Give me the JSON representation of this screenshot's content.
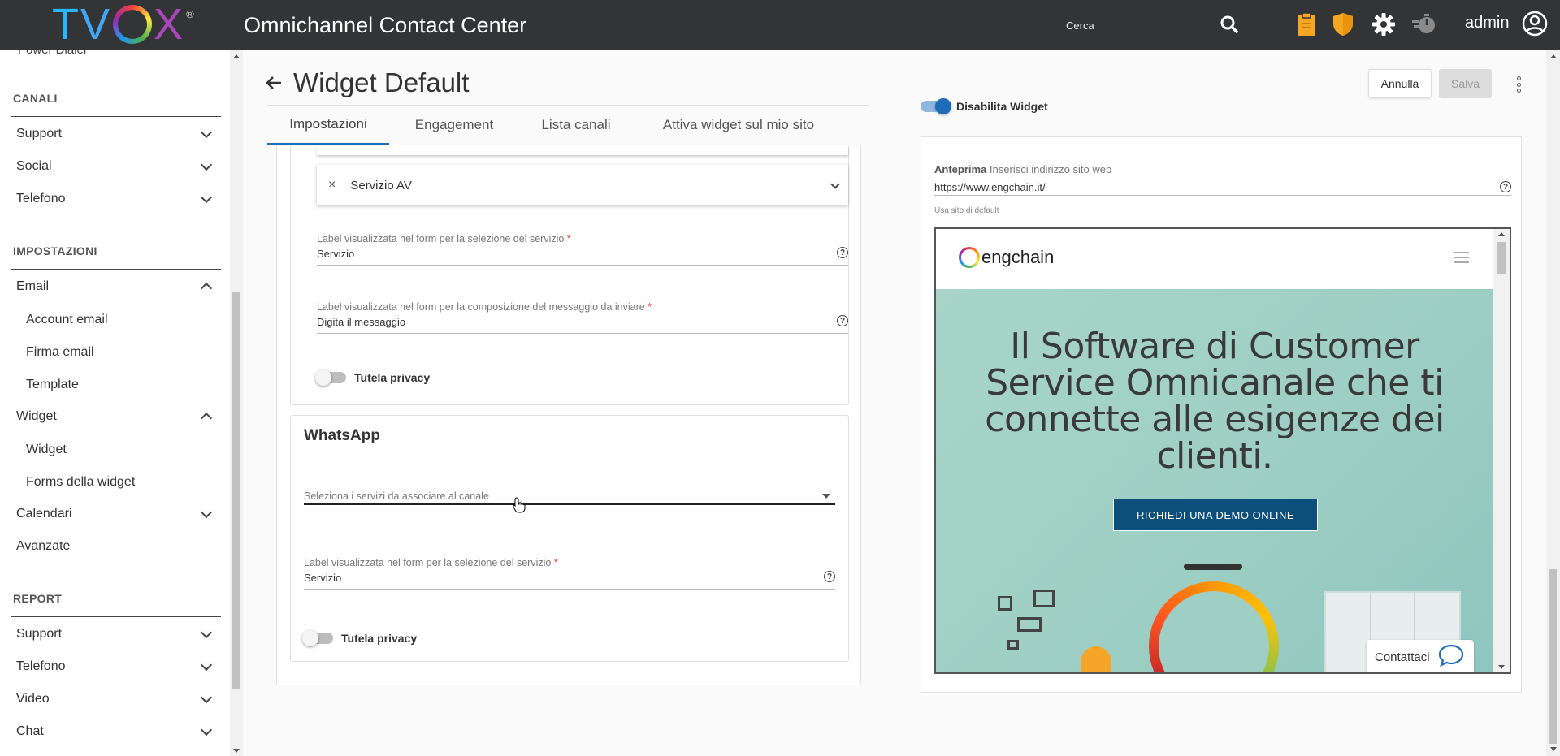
{
  "topbar": {
    "logo_letters": [
      "T",
      "V",
      "X"
    ],
    "logo_reg": "®",
    "app_title": "Omnichannel Contact Center",
    "search_placeholder": "Cerca",
    "user_label": "admin",
    "icons": [
      "search-icon",
      "clipboard-icon",
      "shield-icon",
      "gear-icon",
      "timer-icon",
      "user-circle-icon"
    ],
    "colors": {
      "bg": "#333436",
      "clipboard": "#f5a623",
      "shield": "#f5a623"
    }
  },
  "sidebar": {
    "cut_item": "Power Dialer",
    "sections": [
      {
        "title": "CANALI",
        "items": [
          {
            "label": "Support"
          },
          {
            "label": "Social"
          },
          {
            "label": "Telefono"
          }
        ]
      },
      {
        "title": "IMPOSTAZIONI",
        "items": [
          {
            "label": "Email",
            "expanded": true,
            "sub": [
              "Account email",
              "Firma email",
              "Template"
            ]
          },
          {
            "label": "Widget",
            "expanded": true,
            "sub": [
              "Widget",
              "Forms della widget"
            ]
          },
          {
            "label": "Calendari"
          },
          {
            "label": "Avanzate"
          }
        ]
      },
      {
        "title": "REPORT",
        "items": [
          {
            "label": "Support"
          },
          {
            "label": "Telefono"
          },
          {
            "label": "Video"
          },
          {
            "label": "Chat"
          }
        ]
      }
    ]
  },
  "page": {
    "title": "Widget Default",
    "cancel_label": "Annulla",
    "save_label": "Salva",
    "tabs": [
      "Impostazioni",
      "Engagement",
      "Lista canali",
      "Attiva widget sul mio sito"
    ],
    "active_tab": "Impostazioni",
    "accent": "#1e6bb8"
  },
  "form": {
    "selected_service": "Servizio AV",
    "remove_symbol": "×",
    "service_label_field": {
      "label": "Label visualizzata nel form per la selezione del servizio",
      "required_mark": "*",
      "value": "Servizio"
    },
    "message_label_field": {
      "label": "Label visualizzata nel form per la composizione del messaggio da inviare",
      "required_mark": "*",
      "value": "Digita il messaggio"
    },
    "privacy_toggle": {
      "label": "Tutela privacy",
      "on": false
    },
    "whatsapp": {
      "title": "WhatsApp",
      "services_placeholder": "Seleziona i servizi da associare al canale",
      "service_label_field": {
        "label": "Label visualizzata nel form per la selezione del servizio",
        "required_mark": "*",
        "value": "Servizio"
      },
      "privacy_toggle": {
        "label": "Tutela privacy",
        "on": false
      }
    }
  },
  "preview": {
    "disable_toggle": {
      "label": "Disabilita Widget",
      "on": true
    },
    "label_bold": "Anteprima",
    "label_hint": "Inserisci indirizzo sito web",
    "url": "https://www.engchain.it/",
    "use_default": "Usa sito di default",
    "site": {
      "logo_text": "engchain",
      "hero_title": "Il Software di Customer Service Omnicanale che ti connette alle esigenze dei clienti.",
      "cta": "RICHIEDI UNA DEMO ONLINE",
      "contact_button": "Contattaci",
      "colors": {
        "hero_bg": "#9fcfc4",
        "cta_bg": "#0d4f7c"
      }
    }
  }
}
